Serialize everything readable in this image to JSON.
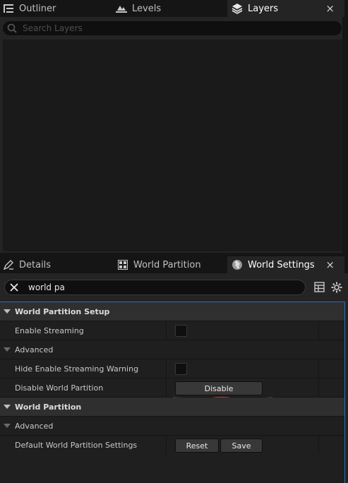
{
  "top_tabs": [
    {
      "label": "Outliner",
      "icon": "outliner-icon"
    },
    {
      "label": "Levels",
      "icon": "levels-icon"
    },
    {
      "label": "Layers",
      "icon": "layers-icon",
      "active": true
    }
  ],
  "top_search": {
    "placeholder": "Search Layers"
  },
  "bottom_tabs": [
    {
      "label": "Details",
      "icon": "details-icon"
    },
    {
      "label": "World Partition",
      "icon": "world-partition-icon"
    },
    {
      "label": "World Settings",
      "icon": "globe-icon",
      "active": true
    }
  ],
  "close_glyph": "×",
  "details_search": {
    "value": "world pa"
  },
  "grid": {
    "wp_setup": "World Partition Setup",
    "enable_streaming": "Enable Streaming",
    "advanced_1": "Advanced",
    "hide_warning": "Hide Enable Streaming Warning",
    "disable_wp": "Disable World Partition",
    "disable_button": "Disable",
    "world_partition": "World Partition",
    "advanced_2": "Advanced",
    "default_settings": "Default World Partition Settings",
    "reset_button": "Reset",
    "save_button": "Save"
  },
  "colors": {
    "annotation": "#d91f1f",
    "accent_border": "#2c6fb2",
    "panel": "#242424"
  }
}
